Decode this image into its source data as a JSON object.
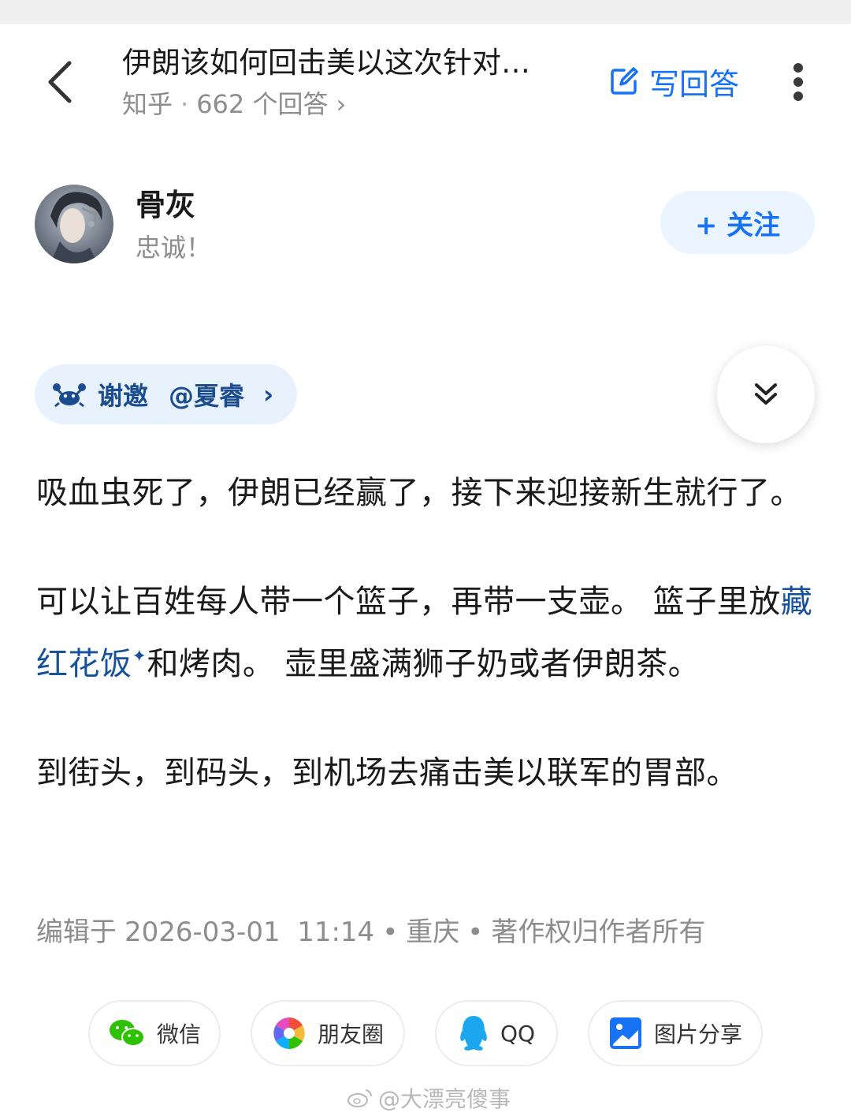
{
  "header": {
    "question_title": "伊朗该如何回击美以这次针对…",
    "source": "知乎",
    "separator": "·",
    "answers_count": "662 个回答",
    "answers_chevron": "›",
    "write_answer_label": "写回答"
  },
  "author": {
    "name": "骨灰",
    "bio": "忠诚！",
    "follow_label": "+ 关注"
  },
  "invite": {
    "label": "谢邀",
    "mention": "@夏睿",
    "chevron": "›"
  },
  "answer": {
    "p1": "吸血虫死了，伊朗已经赢了，接下来迎接新生就行了。",
    "p2_before": "可以让百姓每人带一个篮子，再带一支壶。 篮子里放",
    "p2_link": "藏红花饭",
    "p2_spark": "✦",
    "p2_after": "和烤肉。 壶里盛满狮子奶或者伊朗茶。",
    "p3": "到街头，到码头，到机场去痛击美以联军的胃部。"
  },
  "meta": {
    "edited_prefix": "编辑于",
    "datetime": "2026-03-01  11:14",
    "dot1": "•",
    "location": "重庆",
    "dot2": "•",
    "copyright": "著作权归作者所有"
  },
  "share": {
    "wechat": "微信",
    "moments": "朋友圈",
    "qq": "QQ",
    "image_share": "图片分享"
  },
  "watermark": {
    "text": "@大漂亮傻事"
  },
  "colors": {
    "brand_blue": "#1772f6",
    "link_blue": "#175199",
    "muted_gray": "#8d8d8d",
    "follow_bg": "#ebf5ff",
    "invite_bg": "#e8f2fd"
  },
  "icons": {
    "back": "chevron-left-icon",
    "write": "edit-icon",
    "more": "more-vertical-icon",
    "invite": "crab-icon",
    "collapse": "double-chevron-down-icon",
    "wechat": "wechat-icon",
    "moments": "moments-icon",
    "qq": "qq-icon",
    "image": "image-icon"
  }
}
